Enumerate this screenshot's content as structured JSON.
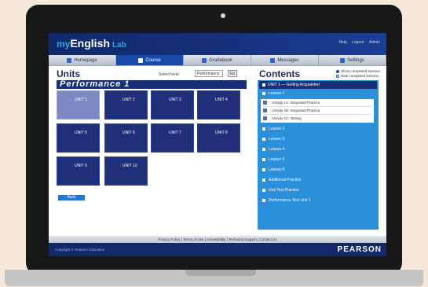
{
  "app": {
    "logo_prefix": "my",
    "logo_main": "English",
    "logo_suffix": "Lab",
    "top_links": [
      "Help",
      "Logout",
      "Admin"
    ]
  },
  "nav": {
    "tabs": [
      {
        "label": "Homepage",
        "active": false
      },
      {
        "label": "Course",
        "active": true
      },
      {
        "label": "Gradebook",
        "active": false
      },
      {
        "label": "Messages",
        "active": false
      },
      {
        "label": "Settings",
        "active": false
      }
    ]
  },
  "units_panel": {
    "title": "Units",
    "filter_label": "Select level:",
    "filter_value": "Performance",
    "go_label": "Go",
    "section_title": "Performance 1",
    "units": [
      "UNIT 1",
      "UNIT 2",
      "UNIT 3",
      "UNIT 4",
      "UNIT 5",
      "UNIT 6",
      "UNIT 7",
      "UNIT 8",
      "UNIT 9",
      "UNIT 10"
    ],
    "selected_unit": "UNIT 1",
    "bottom_button": "Back"
  },
  "contents_panel": {
    "title": "Contents",
    "show_completed": "Show completed lessons",
    "hide_completed": "Hide completed lessons",
    "unit_heading": "UNIT 1 — Getting Acquainted",
    "lesson_heading": "Lesson 1",
    "activities": [
      "Activity 1A: Integrated Practice",
      "Activity 1B: Integrated Practice",
      "Activity 1C: Writing"
    ],
    "lessons": [
      "Lesson 2",
      "Lesson 3",
      "Lesson 4",
      "Lesson 5",
      "Lesson 6",
      "Additional Practice",
      "Unit Test Practice",
      "Performance Test Unit 1"
    ]
  },
  "footer": {
    "links": "Privacy Policy | Terms of Use | Accessibility | Technical Support | Contact Us",
    "copyright": "Copyright © Pearson Education",
    "brand": "PEARSON"
  }
}
